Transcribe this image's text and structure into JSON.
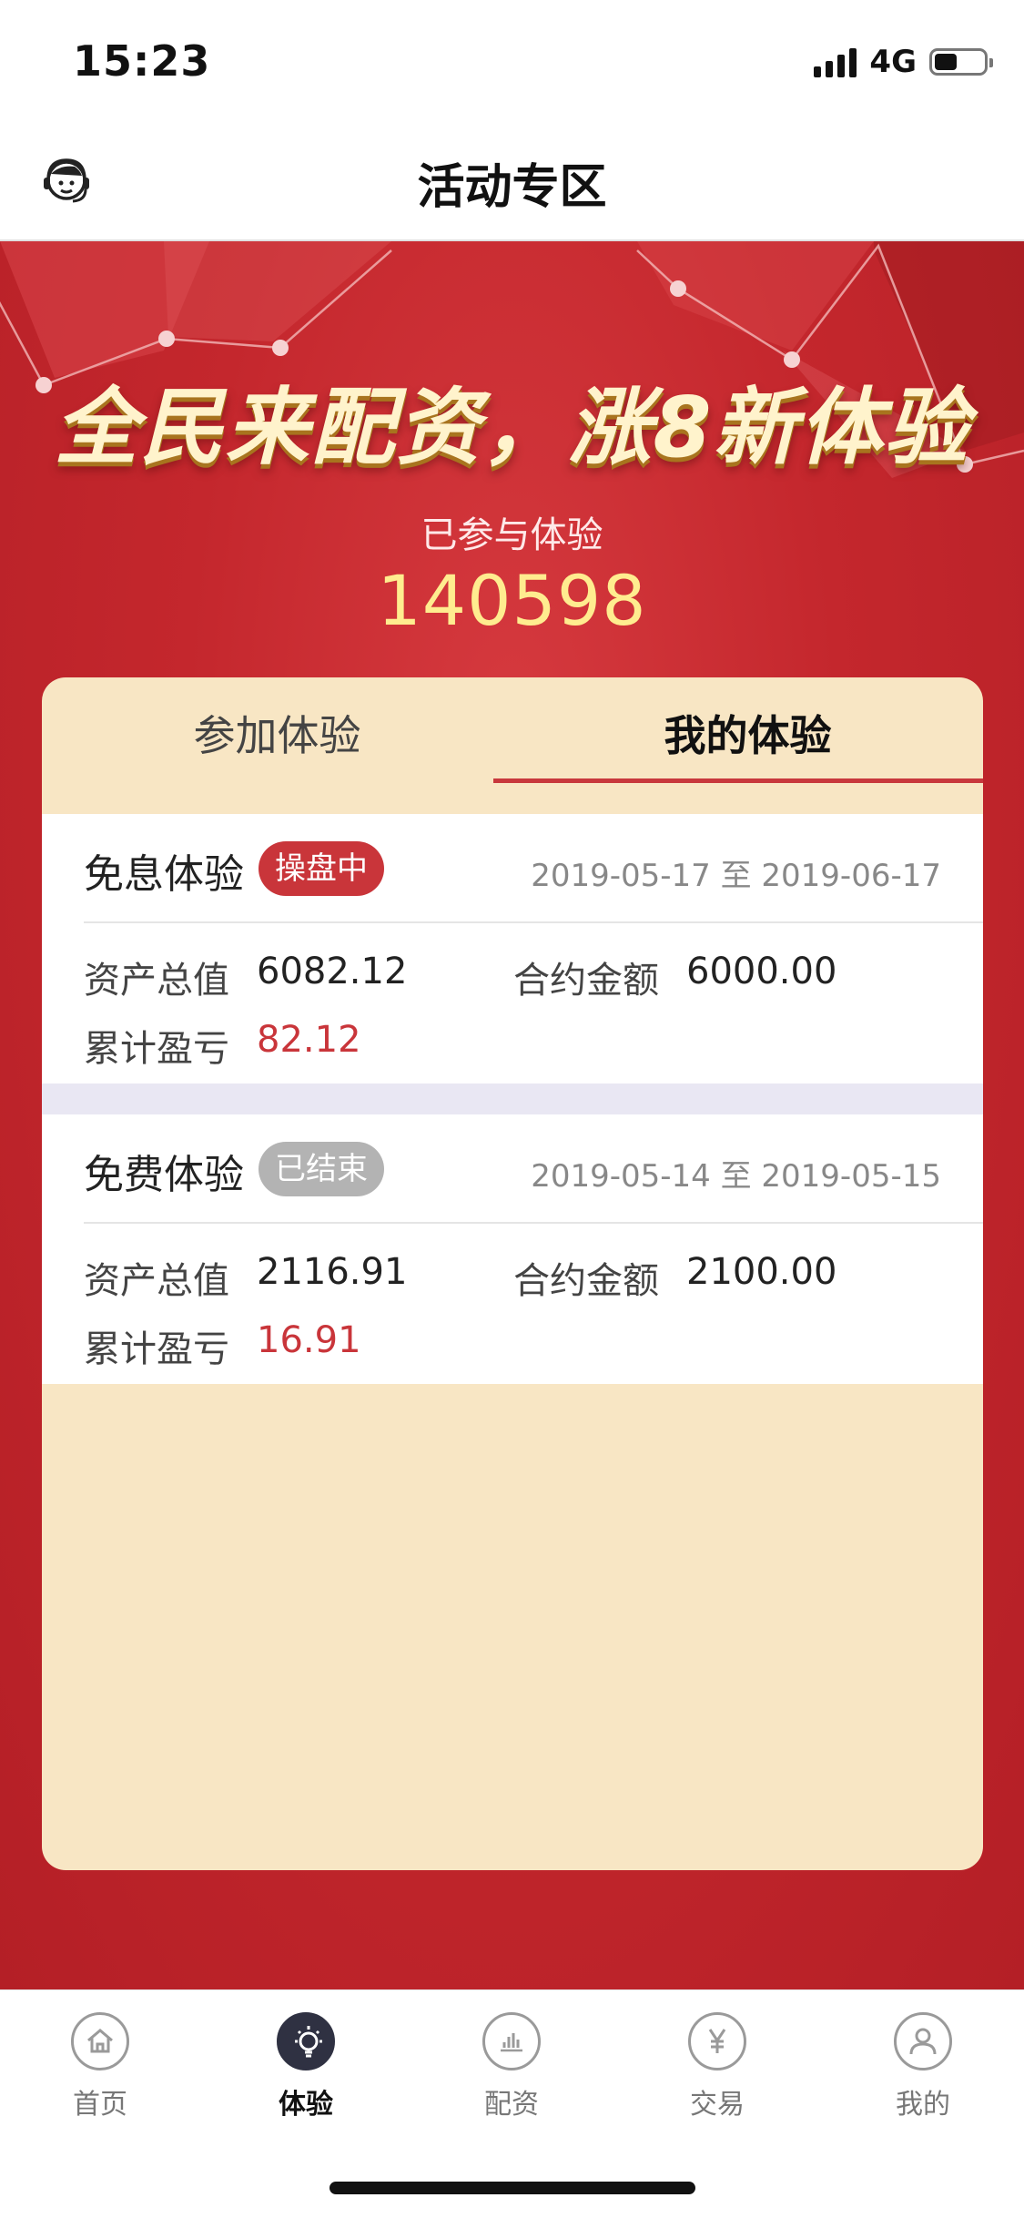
{
  "status_bar": {
    "time": "15:23",
    "network": "4G"
  },
  "nav": {
    "title": "活动专区",
    "left_icon": "customer-service-icon"
  },
  "hero": {
    "banner": "全民来配资，涨8新体验",
    "participated_label": "已参与体验",
    "participated_count": "140598"
  },
  "tabs": [
    {
      "label": "参加体验",
      "active": false
    },
    {
      "label": "我的体验",
      "active": true
    }
  ],
  "records": [
    {
      "name": "免息体验",
      "status": "操盘中",
      "status_color": "#c9353a",
      "date_range": "2019-05-17 至 2019-06-17",
      "asset_label": "资产总值",
      "asset_value": "6082.12",
      "contract_label": "合约金额",
      "contract_value": "6000.00",
      "pnl_label": "累计盈亏",
      "pnl_value": "82.12"
    },
    {
      "name": "免费体验",
      "status": "已结束",
      "status_color": "#b3b3b3",
      "date_range": "2019-05-14 至 2019-05-15",
      "asset_label": "资产总值",
      "asset_value": "2116.91",
      "contract_label": "合约金额",
      "contract_value": "2100.00",
      "pnl_label": "累计盈亏",
      "pnl_value": "16.91"
    }
  ],
  "tabbar": [
    {
      "label": "首页",
      "icon": "home-icon",
      "active": false
    },
    {
      "label": "体验",
      "icon": "lightbulb-icon",
      "active": true
    },
    {
      "label": "配资",
      "icon": "bar-chart-icon",
      "active": false
    },
    {
      "label": "交易",
      "icon": "yen-icon",
      "active": false
    },
    {
      "label": "我的",
      "icon": "user-icon",
      "active": false
    }
  ],
  "colors": {
    "accent_red": "#c9353a",
    "card_bg": "#f8e6c4",
    "count_yellow": "#ffec8f"
  }
}
